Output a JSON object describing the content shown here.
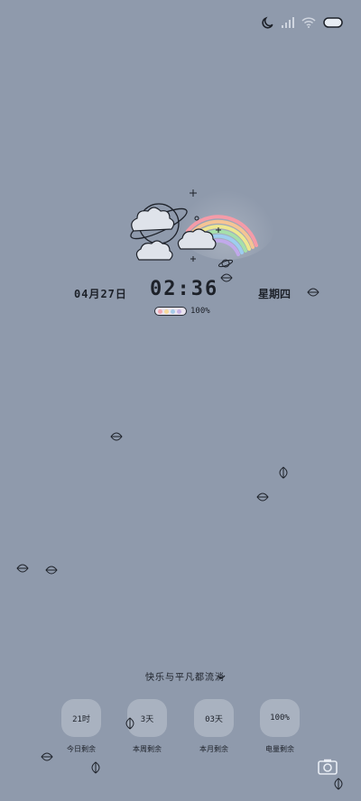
{
  "status_bar": {
    "icons": [
      "moon-icon",
      "signal-icon",
      "wifi-icon",
      "battery-icon"
    ]
  },
  "clock": {
    "date": "04月27日",
    "time": "02:36",
    "weekday": "星期四"
  },
  "battery_widget": {
    "percent_text": "100%",
    "dot_colors": [
      "#f3a9b4",
      "#f6d99a",
      "#a6cbe9",
      "#c7b3e8"
    ]
  },
  "motto": "快乐与平凡都流淌",
  "widgets": [
    {
      "value": "21时",
      "label": "今日剩余"
    },
    {
      "value": "3天",
      "label": "本周剩余"
    },
    {
      "value": "03天",
      "label": "本月剩余"
    },
    {
      "value": "100%",
      "label": "电量剩余"
    }
  ],
  "colors": {
    "background": "#8f9aac",
    "ink": "#1d2129"
  }
}
